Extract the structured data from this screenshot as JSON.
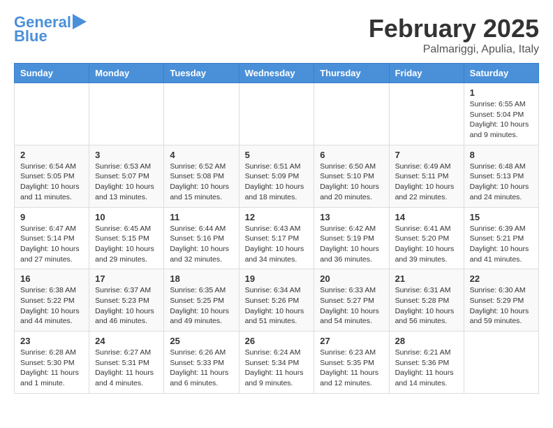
{
  "logo": {
    "line1": "General",
    "line2": "Blue"
  },
  "title": "February 2025",
  "subtitle": "Palmariggi, Apulia, Italy",
  "days_of_week": [
    "Sunday",
    "Monday",
    "Tuesday",
    "Wednesday",
    "Thursday",
    "Friday",
    "Saturday"
  ],
  "weeks": [
    [
      {
        "day": "",
        "info": ""
      },
      {
        "day": "",
        "info": ""
      },
      {
        "day": "",
        "info": ""
      },
      {
        "day": "",
        "info": ""
      },
      {
        "day": "",
        "info": ""
      },
      {
        "day": "",
        "info": ""
      },
      {
        "day": "1",
        "info": "Sunrise: 6:55 AM\nSunset: 5:04 PM\nDaylight: 10 hours and 9 minutes."
      }
    ],
    [
      {
        "day": "2",
        "info": "Sunrise: 6:54 AM\nSunset: 5:05 PM\nDaylight: 10 hours and 11 minutes."
      },
      {
        "day": "3",
        "info": "Sunrise: 6:53 AM\nSunset: 5:07 PM\nDaylight: 10 hours and 13 minutes."
      },
      {
        "day": "4",
        "info": "Sunrise: 6:52 AM\nSunset: 5:08 PM\nDaylight: 10 hours and 15 minutes."
      },
      {
        "day": "5",
        "info": "Sunrise: 6:51 AM\nSunset: 5:09 PM\nDaylight: 10 hours and 18 minutes."
      },
      {
        "day": "6",
        "info": "Sunrise: 6:50 AM\nSunset: 5:10 PM\nDaylight: 10 hours and 20 minutes."
      },
      {
        "day": "7",
        "info": "Sunrise: 6:49 AM\nSunset: 5:11 PM\nDaylight: 10 hours and 22 minutes."
      },
      {
        "day": "8",
        "info": "Sunrise: 6:48 AM\nSunset: 5:13 PM\nDaylight: 10 hours and 24 minutes."
      }
    ],
    [
      {
        "day": "9",
        "info": "Sunrise: 6:47 AM\nSunset: 5:14 PM\nDaylight: 10 hours and 27 minutes."
      },
      {
        "day": "10",
        "info": "Sunrise: 6:45 AM\nSunset: 5:15 PM\nDaylight: 10 hours and 29 minutes."
      },
      {
        "day": "11",
        "info": "Sunrise: 6:44 AM\nSunset: 5:16 PM\nDaylight: 10 hours and 32 minutes."
      },
      {
        "day": "12",
        "info": "Sunrise: 6:43 AM\nSunset: 5:17 PM\nDaylight: 10 hours and 34 minutes."
      },
      {
        "day": "13",
        "info": "Sunrise: 6:42 AM\nSunset: 5:19 PM\nDaylight: 10 hours and 36 minutes."
      },
      {
        "day": "14",
        "info": "Sunrise: 6:41 AM\nSunset: 5:20 PM\nDaylight: 10 hours and 39 minutes."
      },
      {
        "day": "15",
        "info": "Sunrise: 6:39 AM\nSunset: 5:21 PM\nDaylight: 10 hours and 41 minutes."
      }
    ],
    [
      {
        "day": "16",
        "info": "Sunrise: 6:38 AM\nSunset: 5:22 PM\nDaylight: 10 hours and 44 minutes."
      },
      {
        "day": "17",
        "info": "Sunrise: 6:37 AM\nSunset: 5:23 PM\nDaylight: 10 hours and 46 minutes."
      },
      {
        "day": "18",
        "info": "Sunrise: 6:35 AM\nSunset: 5:25 PM\nDaylight: 10 hours and 49 minutes."
      },
      {
        "day": "19",
        "info": "Sunrise: 6:34 AM\nSunset: 5:26 PM\nDaylight: 10 hours and 51 minutes."
      },
      {
        "day": "20",
        "info": "Sunrise: 6:33 AM\nSunset: 5:27 PM\nDaylight: 10 hours and 54 minutes."
      },
      {
        "day": "21",
        "info": "Sunrise: 6:31 AM\nSunset: 5:28 PM\nDaylight: 10 hours and 56 minutes."
      },
      {
        "day": "22",
        "info": "Sunrise: 6:30 AM\nSunset: 5:29 PM\nDaylight: 10 hours and 59 minutes."
      }
    ],
    [
      {
        "day": "23",
        "info": "Sunrise: 6:28 AM\nSunset: 5:30 PM\nDaylight: 11 hours and 1 minute."
      },
      {
        "day": "24",
        "info": "Sunrise: 6:27 AM\nSunset: 5:31 PM\nDaylight: 11 hours and 4 minutes."
      },
      {
        "day": "25",
        "info": "Sunrise: 6:26 AM\nSunset: 5:33 PM\nDaylight: 11 hours and 6 minutes."
      },
      {
        "day": "26",
        "info": "Sunrise: 6:24 AM\nSunset: 5:34 PM\nDaylight: 11 hours and 9 minutes."
      },
      {
        "day": "27",
        "info": "Sunrise: 6:23 AM\nSunset: 5:35 PM\nDaylight: 11 hours and 12 minutes."
      },
      {
        "day": "28",
        "info": "Sunrise: 6:21 AM\nSunset: 5:36 PM\nDaylight: 11 hours and 14 minutes."
      },
      {
        "day": "",
        "info": ""
      }
    ]
  ]
}
